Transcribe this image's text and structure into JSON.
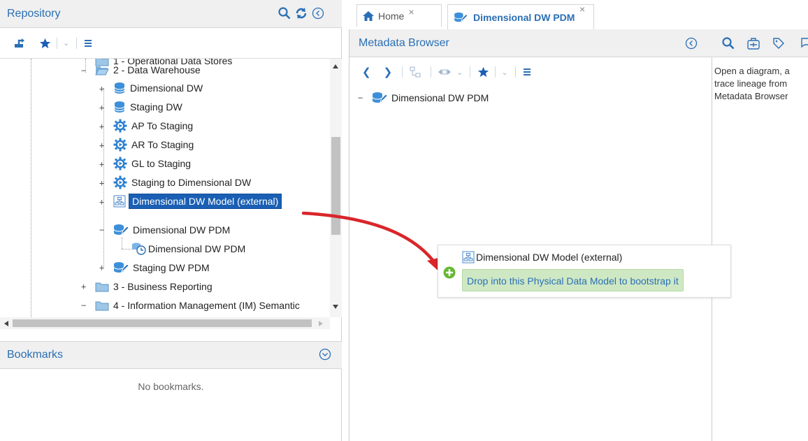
{
  "repository": {
    "title": "Repository",
    "tree": [
      {
        "label": "1 - Operational Data Stores",
        "icon": "folder-icon"
      },
      {
        "label": "2 - Data Warehouse",
        "icon": "folder-open-icon"
      },
      {
        "label": "Dimensional DW",
        "icon": "database-icon"
      },
      {
        "label": "Staging DW",
        "icon": "database-icon"
      },
      {
        "label": "AP To Staging",
        "icon": "gear-play-icon"
      },
      {
        "label": "AR To Staging",
        "icon": "gear-play-icon"
      },
      {
        "label": "GL to Staging",
        "icon": "gear-play-icon"
      },
      {
        "label": "Staging to Dimensional DW",
        "icon": "gear-play-icon"
      },
      {
        "label": "Dimensional DW Model (external)",
        "icon": "model-icon"
      },
      {
        "label": "Dimensional DW PDM",
        "icon": "db-edit-icon"
      },
      {
        "label": "Dimensional DW PDM",
        "icon": "db-clock-icon"
      },
      {
        "label": "Staging DW PDM",
        "icon": "db-edit-icon"
      },
      {
        "label": "3 - Business Reporting",
        "icon": "folder-icon"
      },
      {
        "label": "4 - Information Management (IM) Semantic",
        "icon": "folder-icon"
      }
    ]
  },
  "bookmarks": {
    "title": "Bookmarks",
    "empty_text": "No bookmarks."
  },
  "tabs": [
    {
      "label": "Home",
      "icon": "home-icon"
    },
    {
      "label": "Dimensional DW PDM",
      "icon": "db-edit-icon"
    }
  ],
  "metadata_browser": {
    "title": "Metadata Browser",
    "root_item": "Dimensional DW PDM"
  },
  "right_panel": {
    "text_lines": [
      "Open a diagram, a",
      "trace lineage from",
      "Metadata Browser"
    ]
  },
  "drag": {
    "item_label": "Dimensional DW Model (external)",
    "drop_hint": "Drop into this Physical Data Model to bootstrap it"
  },
  "colors": {
    "accent": "#2a6fb5",
    "selected": "#1a5fb4",
    "drop_hint_bg": "#cfe8c4",
    "arrow": "#d9262a",
    "plus_green": "#66b832"
  }
}
